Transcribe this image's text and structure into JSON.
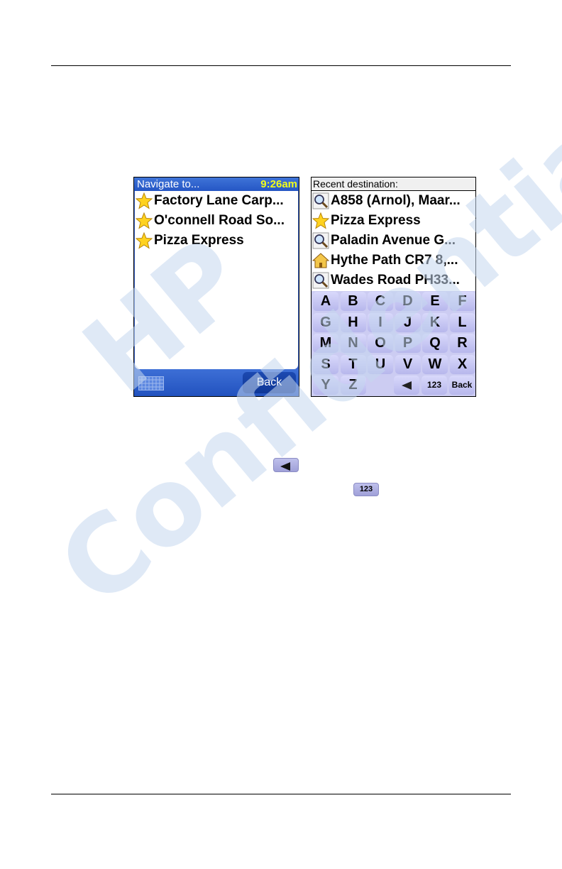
{
  "left_screen": {
    "title": "Navigate to...",
    "clock": "9:26am",
    "items": [
      {
        "label": "Factory Lane Carp...",
        "icon": "star-icon"
      },
      {
        "label": "O'connell Road So...",
        "icon": "star-icon"
      },
      {
        "label": "Pizza Express",
        "icon": "star-icon"
      }
    ],
    "back_label": "Back",
    "keyboard_icon": "keyboard-icon"
  },
  "right_screen": {
    "title": "Recent destination:",
    "items": [
      {
        "label": "A858 (Arnol), Maar...",
        "icon": "magnifier-icon"
      },
      {
        "label": "Pizza Express",
        "icon": "star-icon"
      },
      {
        "label": "Paladin Avenue G...",
        "icon": "magnifier-icon"
      },
      {
        "label": "Hythe Path CR7 8,...",
        "icon": "home-icon"
      },
      {
        "label": "Wades Road PH33...",
        "icon": "magnifier-icon"
      }
    ],
    "keys": [
      "A",
      "B",
      "C",
      "D",
      "E",
      "F",
      "G",
      "H",
      "I",
      "J",
      "K",
      "L",
      "M",
      "N",
      "O",
      "P",
      "Q",
      "R",
      "S",
      "T",
      "U",
      "V",
      "W",
      "X",
      "Y",
      "Z"
    ],
    "numbers_label": "123",
    "back_label": "Back"
  },
  "inline_buttons": {
    "numbers_label": "123"
  },
  "watermark": {
    "line1": "HP",
    "line2": "Confidential",
    "color": "#c5d7ee"
  },
  "colors": {
    "titlebar_blue": "#2f62d0",
    "clock_yellow": "#f2ff1a",
    "key_lavender": "#ccccf2"
  }
}
